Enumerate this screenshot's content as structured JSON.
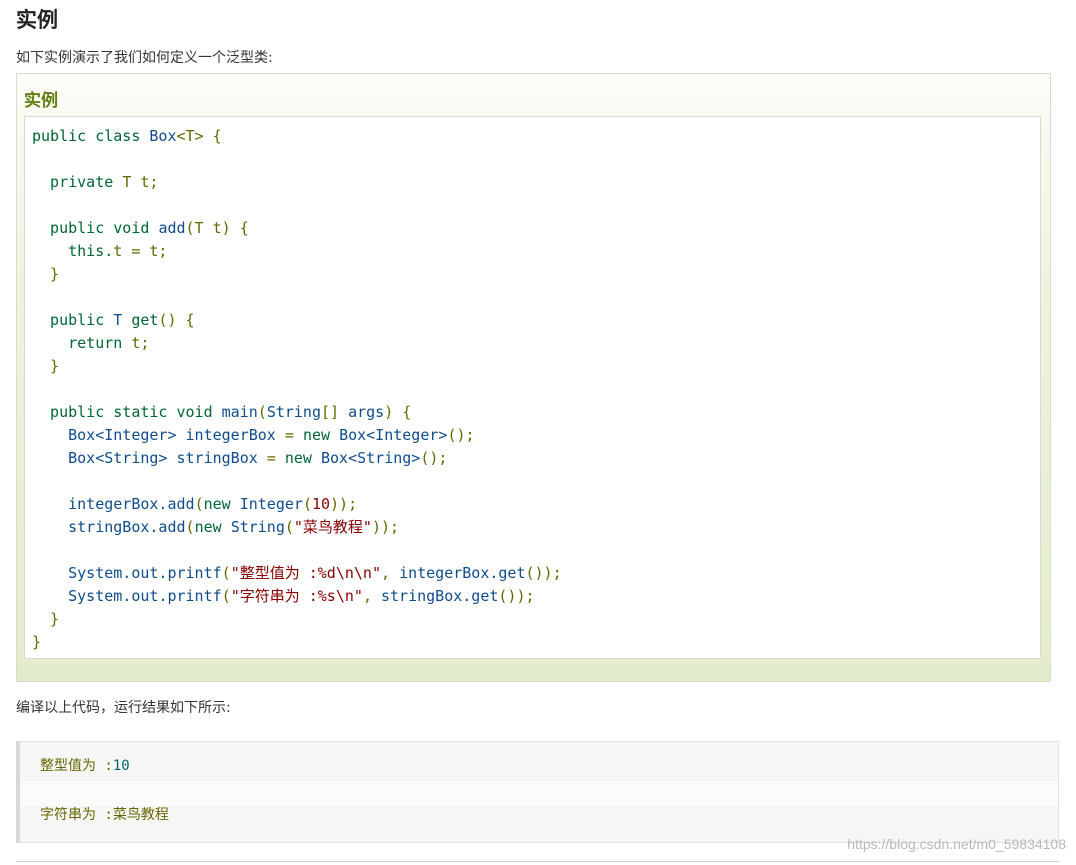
{
  "page": {
    "title": "实例",
    "intro": "如下实例演示了我们如何定义一个泛型类:",
    "after_text": "编译以上代码，运行结果如下所示:",
    "watermark": "https://blog.csdn.net/m0_59834108"
  },
  "example": {
    "title": "实例",
    "lines": [
      [
        {
          "t": "public class ",
          "c": "kw"
        },
        {
          "t": "Box",
          "c": "ty"
        },
        {
          "t": "<T> {",
          "c": "pl"
        }
      ],
      [],
      [
        {
          "t": "  private ",
          "c": "kw"
        },
        {
          "t": "T t;",
          "c": "pl"
        }
      ],
      [],
      [
        {
          "t": "  public ",
          "c": "kw"
        },
        {
          "t": "void ",
          "c": "kw"
        },
        {
          "t": "add",
          "c": "ty"
        },
        {
          "t": "(T t) {",
          "c": "pl"
        }
      ],
      [
        {
          "t": "    this.",
          "c": "kw"
        },
        {
          "t": "t = t;",
          "c": "pl"
        }
      ],
      [
        {
          "t": "  }",
          "c": "pl"
        }
      ],
      [],
      [
        {
          "t": "  public ",
          "c": "kw"
        },
        {
          "t": "T ",
          "c": "ty"
        },
        {
          "t": "get",
          "c": "kw"
        },
        {
          "t": "() {",
          "c": "pl"
        }
      ],
      [
        {
          "t": "    return ",
          "c": "kw"
        },
        {
          "t": "t;",
          "c": "pl"
        }
      ],
      [
        {
          "t": "  }",
          "c": "pl"
        }
      ],
      [],
      [
        {
          "t": "  public ",
          "c": "kw"
        },
        {
          "t": "static ",
          "c": "kw"
        },
        {
          "t": "void ",
          "c": "kw"
        },
        {
          "t": "main",
          "c": "ty"
        },
        {
          "t": "(",
          "c": "pl"
        },
        {
          "t": "String",
          "c": "ty"
        },
        {
          "t": "[] ",
          "c": "pl"
        },
        {
          "t": "args",
          "c": "ty"
        },
        {
          "t": ") {",
          "c": "pl"
        }
      ],
      [
        {
          "t": "    Box<Integer> integerBox",
          "c": "ty"
        },
        {
          "t": " = ",
          "c": "pl"
        },
        {
          "t": "new ",
          "c": "kw"
        },
        {
          "t": "Box<Integer>",
          "c": "ty"
        },
        {
          "t": "();",
          "c": "pl"
        }
      ],
      [
        {
          "t": "    Box<String> stringBox",
          "c": "ty"
        },
        {
          "t": " = ",
          "c": "pl"
        },
        {
          "t": "new ",
          "c": "kw"
        },
        {
          "t": "Box<String>",
          "c": "ty"
        },
        {
          "t": "();",
          "c": "pl"
        }
      ],
      [],
      [
        {
          "t": "    integerBox.add",
          "c": "ty"
        },
        {
          "t": "(",
          "c": "pl"
        },
        {
          "t": "new ",
          "c": "kw"
        },
        {
          "t": "Integer",
          "c": "ty"
        },
        {
          "t": "(",
          "c": "pl"
        },
        {
          "t": "10",
          "c": "st"
        },
        {
          "t": "));",
          "c": "pl"
        }
      ],
      [
        {
          "t": "    stringBox.add",
          "c": "ty"
        },
        {
          "t": "(",
          "c": "pl"
        },
        {
          "t": "new ",
          "c": "kw"
        },
        {
          "t": "String",
          "c": "ty"
        },
        {
          "t": "(",
          "c": "pl"
        },
        {
          "t": "\"菜鸟教程\"",
          "c": "st"
        },
        {
          "t": "));",
          "c": "pl"
        }
      ],
      [],
      [
        {
          "t": "    System.out.printf",
          "c": "ty"
        },
        {
          "t": "(",
          "c": "pl"
        },
        {
          "t": "\"整型值为 :%d\\n\\n\"",
          "c": "st"
        },
        {
          "t": ", ",
          "c": "pl"
        },
        {
          "t": "integerBox.get",
          "c": "ty"
        },
        {
          "t": "());",
          "c": "pl"
        }
      ],
      [
        {
          "t": "    System.out.printf",
          "c": "ty"
        },
        {
          "t": "(",
          "c": "pl"
        },
        {
          "t": "\"字符串为 :%s\\n\"",
          "c": "st"
        },
        {
          "t": ", ",
          "c": "pl"
        },
        {
          "t": "stringBox.get",
          "c": "ty"
        },
        {
          "t": "());",
          "c": "pl"
        }
      ],
      [
        {
          "t": "  }",
          "c": "pl"
        }
      ],
      [
        {
          "t": "}",
          "c": "pl"
        }
      ]
    ]
  },
  "output": {
    "lines": [
      [
        {
          "t": "整型值为 :",
          "c": "pl"
        },
        {
          "t": "10",
          "c": "nm"
        }
      ],
      [],
      [
        {
          "t": "字符串为 :菜鸟教程",
          "c": "pl"
        }
      ]
    ]
  }
}
